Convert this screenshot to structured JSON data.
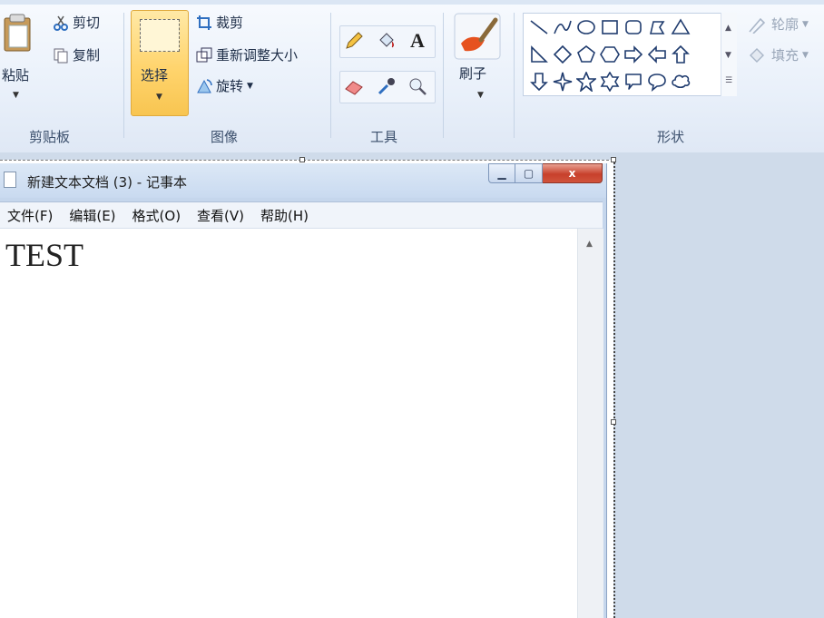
{
  "ribbon": {
    "clipboard": {
      "paste_label": "粘贴",
      "cut_label": "剪切",
      "copy_label": "复制",
      "group_label": "剪贴板"
    },
    "image": {
      "select_label": "选择",
      "crop_label": "裁剪",
      "resize_label": "重新调整大小",
      "rotate_label": "旋转",
      "group_label": "图像"
    },
    "tools": {
      "text_tool_glyph": "A",
      "group_label": "工具"
    },
    "brushes": {
      "label": "刷子"
    },
    "shapes": {
      "outline_label": "轮廓",
      "fill_label": "填充",
      "group_label": "形状"
    }
  },
  "notepad": {
    "title": "新建文本文档 (3) - 记事本",
    "menu": [
      "文件(F)",
      "编辑(E)",
      "格式(O)",
      "查看(V)",
      "帮助(H)"
    ],
    "content": "TEST",
    "close_glyph": "x"
  },
  "colors": {
    "select_highlight": "#ffd46d",
    "close_button": "#c7402b",
    "ribbon_bg": "#e9f0fa"
  }
}
